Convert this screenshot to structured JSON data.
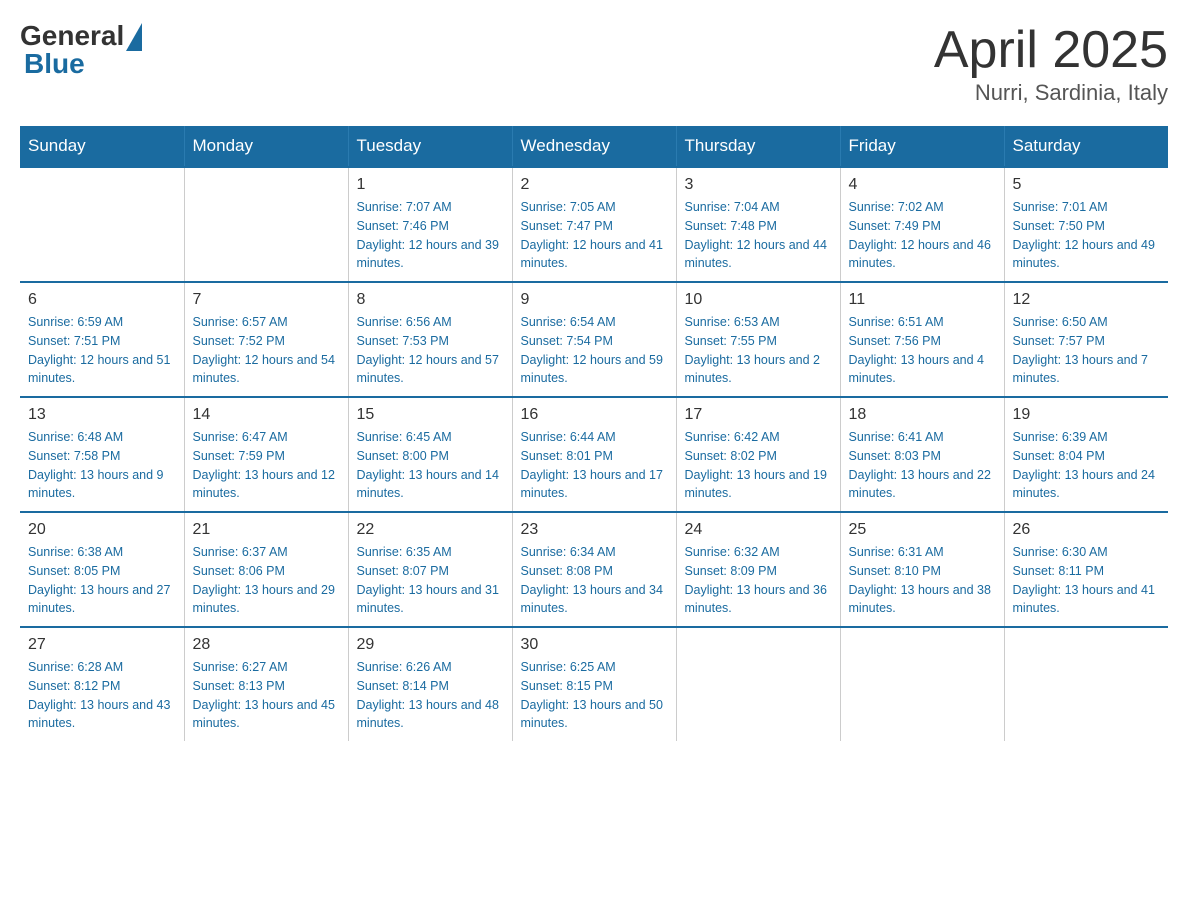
{
  "logo": {
    "general": "General",
    "blue": "Blue"
  },
  "title": "April 2025",
  "subtitle": "Nurri, Sardinia, Italy",
  "weekdays": [
    "Sunday",
    "Monday",
    "Tuesday",
    "Wednesday",
    "Thursday",
    "Friday",
    "Saturday"
  ],
  "weeks": [
    [
      {
        "day": "",
        "sunrise": "",
        "sunset": "",
        "daylight": ""
      },
      {
        "day": "",
        "sunrise": "",
        "sunset": "",
        "daylight": ""
      },
      {
        "day": "1",
        "sunrise": "Sunrise: 7:07 AM",
        "sunset": "Sunset: 7:46 PM",
        "daylight": "Daylight: 12 hours and 39 minutes."
      },
      {
        "day": "2",
        "sunrise": "Sunrise: 7:05 AM",
        "sunset": "Sunset: 7:47 PM",
        "daylight": "Daylight: 12 hours and 41 minutes."
      },
      {
        "day": "3",
        "sunrise": "Sunrise: 7:04 AM",
        "sunset": "Sunset: 7:48 PM",
        "daylight": "Daylight: 12 hours and 44 minutes."
      },
      {
        "day": "4",
        "sunrise": "Sunrise: 7:02 AM",
        "sunset": "Sunset: 7:49 PM",
        "daylight": "Daylight: 12 hours and 46 minutes."
      },
      {
        "day": "5",
        "sunrise": "Sunrise: 7:01 AM",
        "sunset": "Sunset: 7:50 PM",
        "daylight": "Daylight: 12 hours and 49 minutes."
      }
    ],
    [
      {
        "day": "6",
        "sunrise": "Sunrise: 6:59 AM",
        "sunset": "Sunset: 7:51 PM",
        "daylight": "Daylight: 12 hours and 51 minutes."
      },
      {
        "day": "7",
        "sunrise": "Sunrise: 6:57 AM",
        "sunset": "Sunset: 7:52 PM",
        "daylight": "Daylight: 12 hours and 54 minutes."
      },
      {
        "day": "8",
        "sunrise": "Sunrise: 6:56 AM",
        "sunset": "Sunset: 7:53 PM",
        "daylight": "Daylight: 12 hours and 57 minutes."
      },
      {
        "day": "9",
        "sunrise": "Sunrise: 6:54 AM",
        "sunset": "Sunset: 7:54 PM",
        "daylight": "Daylight: 12 hours and 59 minutes."
      },
      {
        "day": "10",
        "sunrise": "Sunrise: 6:53 AM",
        "sunset": "Sunset: 7:55 PM",
        "daylight": "Daylight: 13 hours and 2 minutes."
      },
      {
        "day": "11",
        "sunrise": "Sunrise: 6:51 AM",
        "sunset": "Sunset: 7:56 PM",
        "daylight": "Daylight: 13 hours and 4 minutes."
      },
      {
        "day": "12",
        "sunrise": "Sunrise: 6:50 AM",
        "sunset": "Sunset: 7:57 PM",
        "daylight": "Daylight: 13 hours and 7 minutes."
      }
    ],
    [
      {
        "day": "13",
        "sunrise": "Sunrise: 6:48 AM",
        "sunset": "Sunset: 7:58 PM",
        "daylight": "Daylight: 13 hours and 9 minutes."
      },
      {
        "day": "14",
        "sunrise": "Sunrise: 6:47 AM",
        "sunset": "Sunset: 7:59 PM",
        "daylight": "Daylight: 13 hours and 12 minutes."
      },
      {
        "day": "15",
        "sunrise": "Sunrise: 6:45 AM",
        "sunset": "Sunset: 8:00 PM",
        "daylight": "Daylight: 13 hours and 14 minutes."
      },
      {
        "day": "16",
        "sunrise": "Sunrise: 6:44 AM",
        "sunset": "Sunset: 8:01 PM",
        "daylight": "Daylight: 13 hours and 17 minutes."
      },
      {
        "day": "17",
        "sunrise": "Sunrise: 6:42 AM",
        "sunset": "Sunset: 8:02 PM",
        "daylight": "Daylight: 13 hours and 19 minutes."
      },
      {
        "day": "18",
        "sunrise": "Sunrise: 6:41 AM",
        "sunset": "Sunset: 8:03 PM",
        "daylight": "Daylight: 13 hours and 22 minutes."
      },
      {
        "day": "19",
        "sunrise": "Sunrise: 6:39 AM",
        "sunset": "Sunset: 8:04 PM",
        "daylight": "Daylight: 13 hours and 24 minutes."
      }
    ],
    [
      {
        "day": "20",
        "sunrise": "Sunrise: 6:38 AM",
        "sunset": "Sunset: 8:05 PM",
        "daylight": "Daylight: 13 hours and 27 minutes."
      },
      {
        "day": "21",
        "sunrise": "Sunrise: 6:37 AM",
        "sunset": "Sunset: 8:06 PM",
        "daylight": "Daylight: 13 hours and 29 minutes."
      },
      {
        "day": "22",
        "sunrise": "Sunrise: 6:35 AM",
        "sunset": "Sunset: 8:07 PM",
        "daylight": "Daylight: 13 hours and 31 minutes."
      },
      {
        "day": "23",
        "sunrise": "Sunrise: 6:34 AM",
        "sunset": "Sunset: 8:08 PM",
        "daylight": "Daylight: 13 hours and 34 minutes."
      },
      {
        "day": "24",
        "sunrise": "Sunrise: 6:32 AM",
        "sunset": "Sunset: 8:09 PM",
        "daylight": "Daylight: 13 hours and 36 minutes."
      },
      {
        "day": "25",
        "sunrise": "Sunrise: 6:31 AM",
        "sunset": "Sunset: 8:10 PM",
        "daylight": "Daylight: 13 hours and 38 minutes."
      },
      {
        "day": "26",
        "sunrise": "Sunrise: 6:30 AM",
        "sunset": "Sunset: 8:11 PM",
        "daylight": "Daylight: 13 hours and 41 minutes."
      }
    ],
    [
      {
        "day": "27",
        "sunrise": "Sunrise: 6:28 AM",
        "sunset": "Sunset: 8:12 PM",
        "daylight": "Daylight: 13 hours and 43 minutes."
      },
      {
        "day": "28",
        "sunrise": "Sunrise: 6:27 AM",
        "sunset": "Sunset: 8:13 PM",
        "daylight": "Daylight: 13 hours and 45 minutes."
      },
      {
        "day": "29",
        "sunrise": "Sunrise: 6:26 AM",
        "sunset": "Sunset: 8:14 PM",
        "daylight": "Daylight: 13 hours and 48 minutes."
      },
      {
        "day": "30",
        "sunrise": "Sunrise: 6:25 AM",
        "sunset": "Sunset: 8:15 PM",
        "daylight": "Daylight: 13 hours and 50 minutes."
      },
      {
        "day": "",
        "sunrise": "",
        "sunset": "",
        "daylight": ""
      },
      {
        "day": "",
        "sunrise": "",
        "sunset": "",
        "daylight": ""
      },
      {
        "day": "",
        "sunrise": "",
        "sunset": "",
        "daylight": ""
      }
    ]
  ]
}
